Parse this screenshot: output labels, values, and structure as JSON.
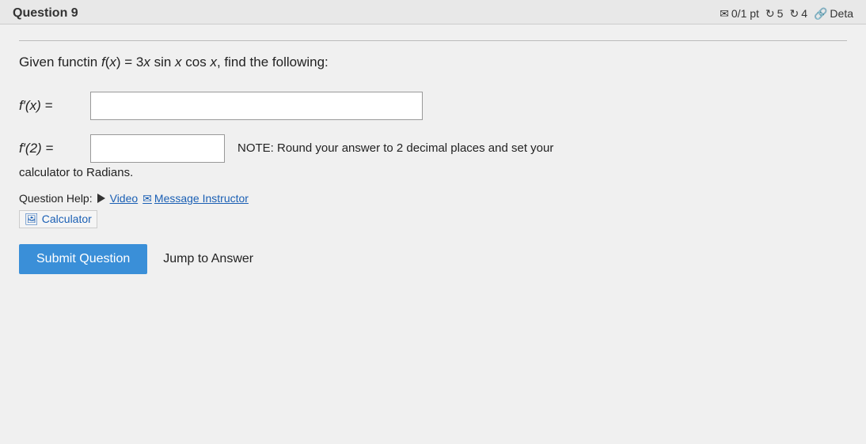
{
  "header": {
    "question_title": "Question 9",
    "score_label": "0/1 pt",
    "retry_label": "5",
    "details_label": "4",
    "deta_label": "Deta"
  },
  "question": {
    "text_prefix": "Given functin ",
    "function_def": "f(x) = 3x sin x cos x",
    "text_suffix": ", find the following:",
    "derivative_label": "f′(x) =",
    "derivative_at_label": "f′(2) =",
    "note_text": "NOTE: Round your answer to 2 decimal places and set your",
    "radians_text": "calculator to Radians.",
    "help_label": "Question Help:",
    "video_label": "Video",
    "message_label": "Message Instructor",
    "calculator_label": "Calculator"
  },
  "buttons": {
    "submit_label": "Submit Question",
    "jump_label": "Jump to Answer"
  },
  "inputs": {
    "derivative_placeholder": "",
    "derivative_at_placeholder": ""
  }
}
